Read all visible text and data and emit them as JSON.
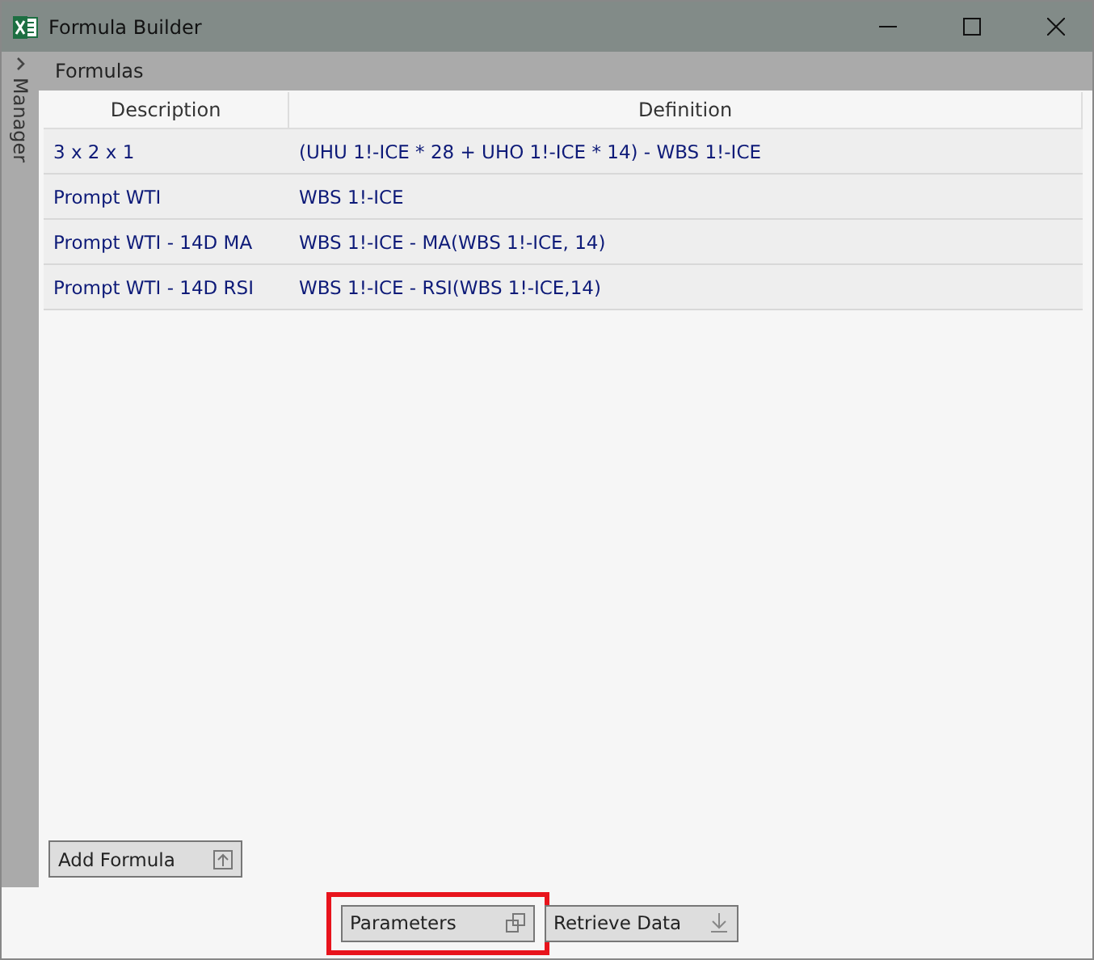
{
  "window": {
    "title": "Formula Builder"
  },
  "sidebar": {
    "label": "Manager"
  },
  "panel": {
    "title": "Formulas"
  },
  "table": {
    "columns": [
      "Description",
      "Definition"
    ],
    "rows": [
      {
        "description": "3 x 2 x 1",
        "definition": "(UHU 1!-ICE * 28 + UHO 1!-ICE * 14) - WBS 1!-ICE"
      },
      {
        "description": "Prompt WTI",
        "definition": "WBS 1!-ICE"
      },
      {
        "description": "Prompt WTI - 14D MA",
        "definition": "WBS 1!-ICE - MA(WBS 1!-ICE, 14)"
      },
      {
        "description": "Prompt WTI - 14D RSI",
        "definition": "WBS 1!-ICE - RSI(WBS 1!-ICE,14)"
      }
    ]
  },
  "add_button": {
    "label": "Add Formula"
  },
  "buttons": [
    {
      "label": "Parameters",
      "kind": "popout",
      "highlighted": true
    },
    {
      "label": "Retrieve Data",
      "kind": "download",
      "highlighted": false
    }
  ]
}
